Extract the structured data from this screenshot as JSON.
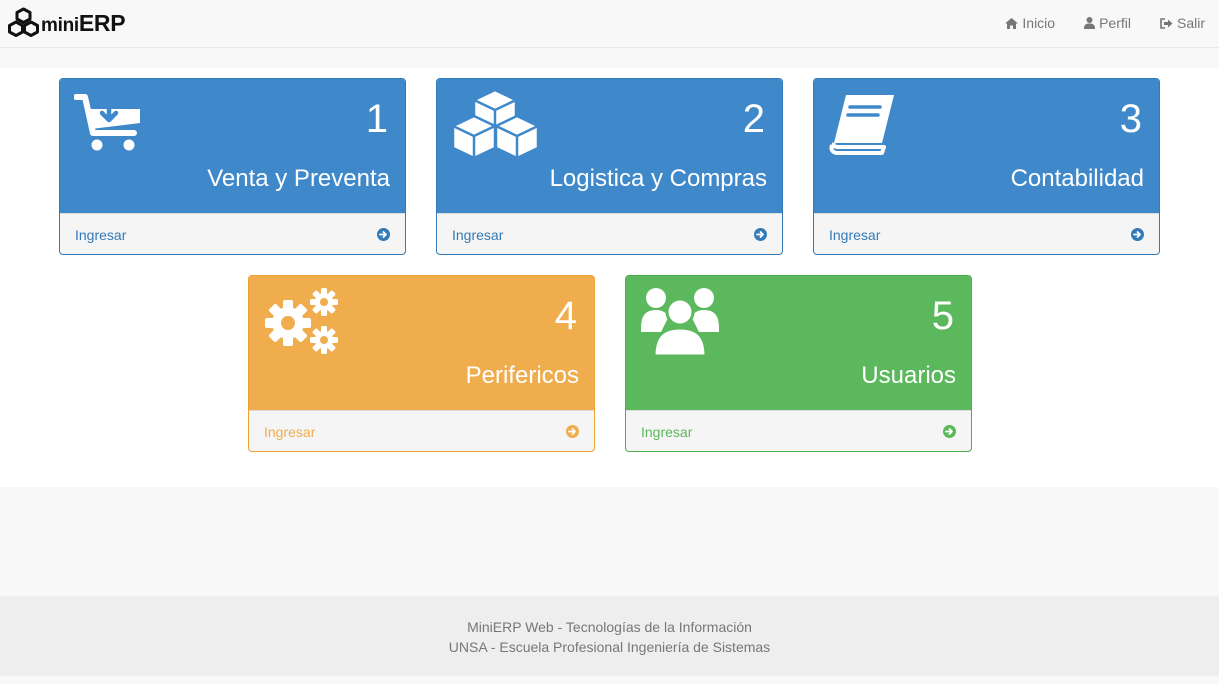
{
  "brand": {
    "prefix": "mini",
    "name": "ERP",
    "logo_icon": "cubes-icon"
  },
  "nav": {
    "items": [
      {
        "label": "Inicio",
        "icon": "home-icon"
      },
      {
        "label": "Perfil",
        "icon": "user-icon"
      },
      {
        "label": "Salir",
        "icon": "sign-out-icon"
      }
    ]
  },
  "modules": [
    {
      "number": "1",
      "title": "Venta y Preventa",
      "link": "Ingresar",
      "icon": "cart-download-icon",
      "color": "#3f89cb"
    },
    {
      "number": "2",
      "title": "Logistica y Compras",
      "link": "Ingresar",
      "icon": "cubes-icon",
      "color": "#3f89cb"
    },
    {
      "number": "3",
      "title": "Contabilidad",
      "link": "Ingresar",
      "icon": "book-icon",
      "color": "#3f89cb"
    },
    {
      "number": "4",
      "title": "Perifericos",
      "link": "Ingresar",
      "icon": "gears-icon",
      "color": "#f0ad4e"
    },
    {
      "number": "5",
      "title": "Usuarios",
      "link": "Ingresar",
      "icon": "users-icon",
      "color": "#5cb85c"
    }
  ],
  "footer": {
    "line1": "MiniERP Web - Tecnologías de la Información",
    "line2": "UNSA - Escuela Profesional Ingeniería de Sistemas"
  }
}
